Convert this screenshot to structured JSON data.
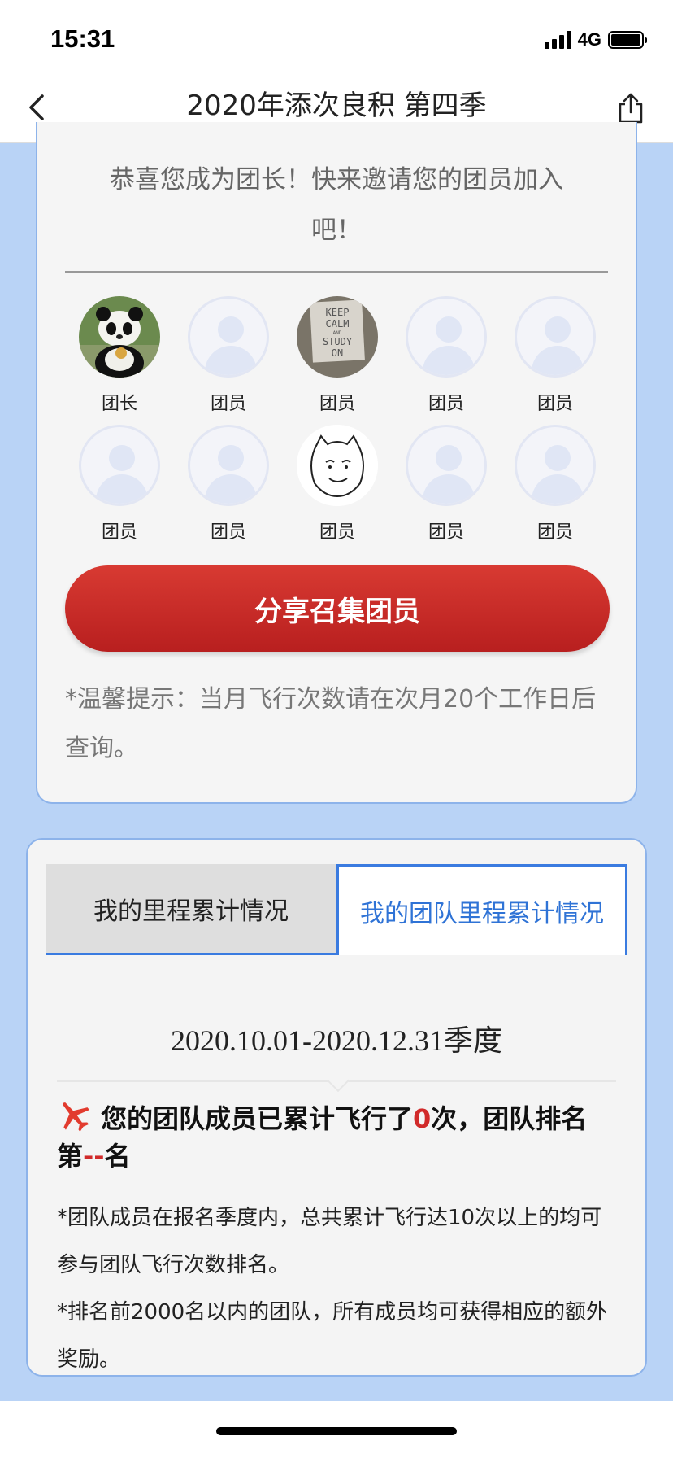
{
  "status_bar": {
    "time": "15:31",
    "network": "4G"
  },
  "nav": {
    "title": "2020年添次良积 第四季"
  },
  "team": {
    "congrats": "恭喜您成为团长！快来邀请您的团员加入吧！",
    "members": [
      {
        "label": "团长",
        "avatar": "panda-photo"
      },
      {
        "label": "团员",
        "avatar": "placeholder"
      },
      {
        "label": "团员",
        "avatar": "keep-calm-photo"
      },
      {
        "label": "团员",
        "avatar": "placeholder"
      },
      {
        "label": "团员",
        "avatar": "placeholder"
      },
      {
        "label": "团员",
        "avatar": "placeholder"
      },
      {
        "label": "团员",
        "avatar": "placeholder"
      },
      {
        "label": "团员",
        "avatar": "cartoon-face"
      },
      {
        "label": "团员",
        "avatar": "placeholder"
      },
      {
        "label": "团员",
        "avatar": "placeholder"
      }
    ],
    "share_button": "分享召集团员",
    "tip": "*温馨提示：当月飞行次数请在次月20个工作日后查询。"
  },
  "mileage": {
    "tabs": [
      {
        "label": "我的里程累计情况",
        "active": false
      },
      {
        "label": "我的团队里程累计情况",
        "active": true
      }
    ],
    "date_range": "2020.10.01-2020.12.31季度",
    "headline_prefix": "您的团队成员已累计飞行了",
    "flight_count": "0",
    "headline_mid": "次，团队排名第",
    "rank": "--",
    "headline_suffix": "名",
    "note1": "*团队成员在报名季度内，总共累计飞行达10次以上的均可参与团队飞行次数排名。",
    "note2": "*排名前2000名以内的团队，所有成员均可获得相应的额外奖励。"
  },
  "colors": {
    "accent_red": "#d12a2a",
    "tab_blue": "#2f73d6",
    "page_bg": "#b9d3f6"
  }
}
